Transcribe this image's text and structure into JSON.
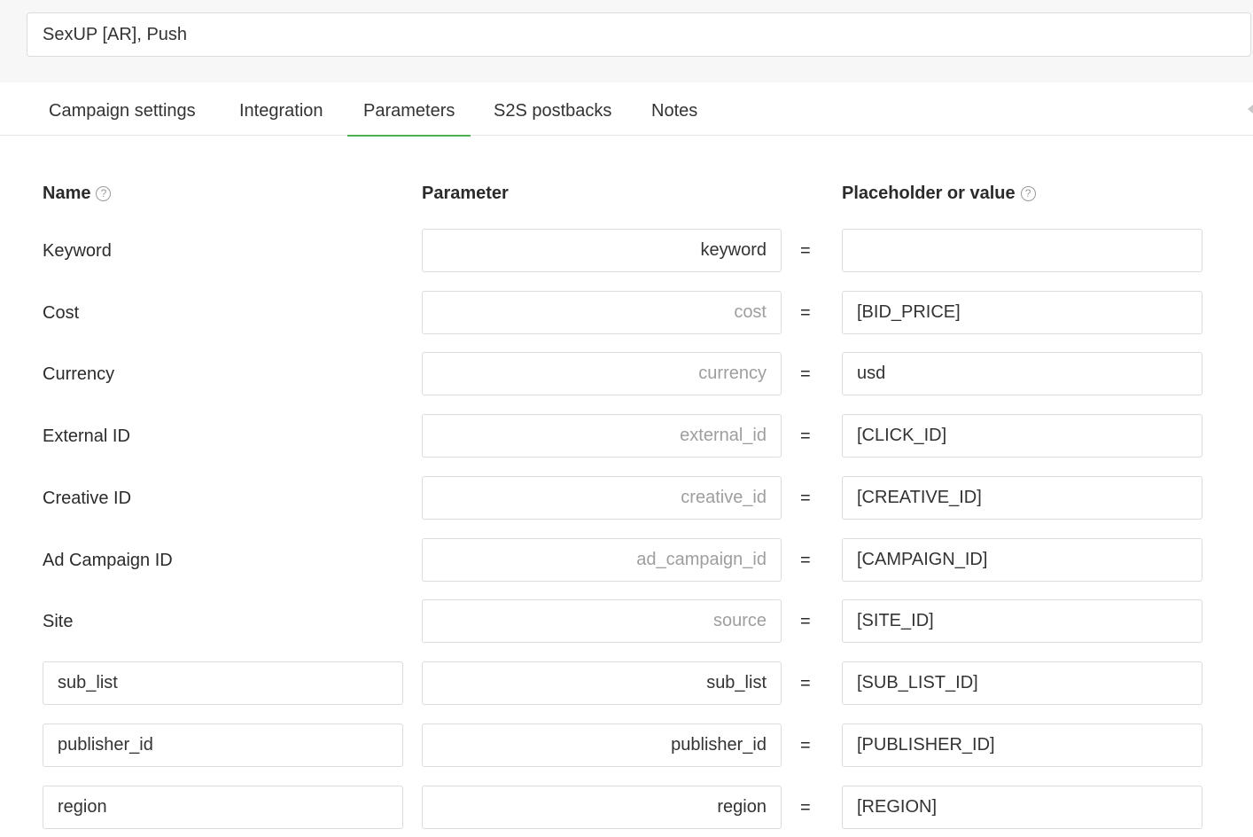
{
  "campaign": {
    "title": "SexUP [AR], Push"
  },
  "tabs": [
    {
      "label": "Campaign settings"
    },
    {
      "label": "Integration"
    },
    {
      "label": "Parameters"
    },
    {
      "label": "S2S postbacks"
    },
    {
      "label": "Notes"
    }
  ],
  "columns": {
    "name": "Name",
    "parameter": "Parameter",
    "value": "Placeholder or value",
    "help_glyph": "?"
  },
  "equals": "=",
  "rows": [
    {
      "name": "Keyword",
      "param_value": "keyword",
      "param_placeholder": "",
      "value": ""
    },
    {
      "name": "Cost",
      "param_value": "",
      "param_placeholder": "cost",
      "value": "[BID_PRICE]"
    },
    {
      "name": "Currency",
      "param_value": "",
      "param_placeholder": "currency",
      "value": "usd"
    },
    {
      "name": "External ID",
      "param_value": "",
      "param_placeholder": "external_id",
      "value": "[CLICK_ID]"
    },
    {
      "name": "Creative ID",
      "param_value": "",
      "param_placeholder": "creative_id",
      "value": "[CREATIVE_ID]"
    },
    {
      "name": "Ad Campaign ID",
      "param_value": "",
      "param_placeholder": "ad_campaign_id",
      "value": "[CAMPAIGN_ID]"
    },
    {
      "name": "Site",
      "param_value": "",
      "param_placeholder": "source",
      "value": "[SITE_ID]"
    },
    {
      "name": "sub_list",
      "param_value": "sub_list",
      "param_placeholder": "",
      "value": "[SUB_LIST_ID]"
    },
    {
      "name": "publisher_id",
      "param_value": "publisher_id",
      "param_placeholder": "",
      "value": "[PUBLISHER_ID]"
    },
    {
      "name": "region",
      "param_value": "region",
      "param_placeholder": "",
      "value": "[REGION]"
    }
  ],
  "colors": {
    "accent": "#4caf50",
    "placeholder": "#9e9e9e",
    "border": "#dcdcdc"
  }
}
